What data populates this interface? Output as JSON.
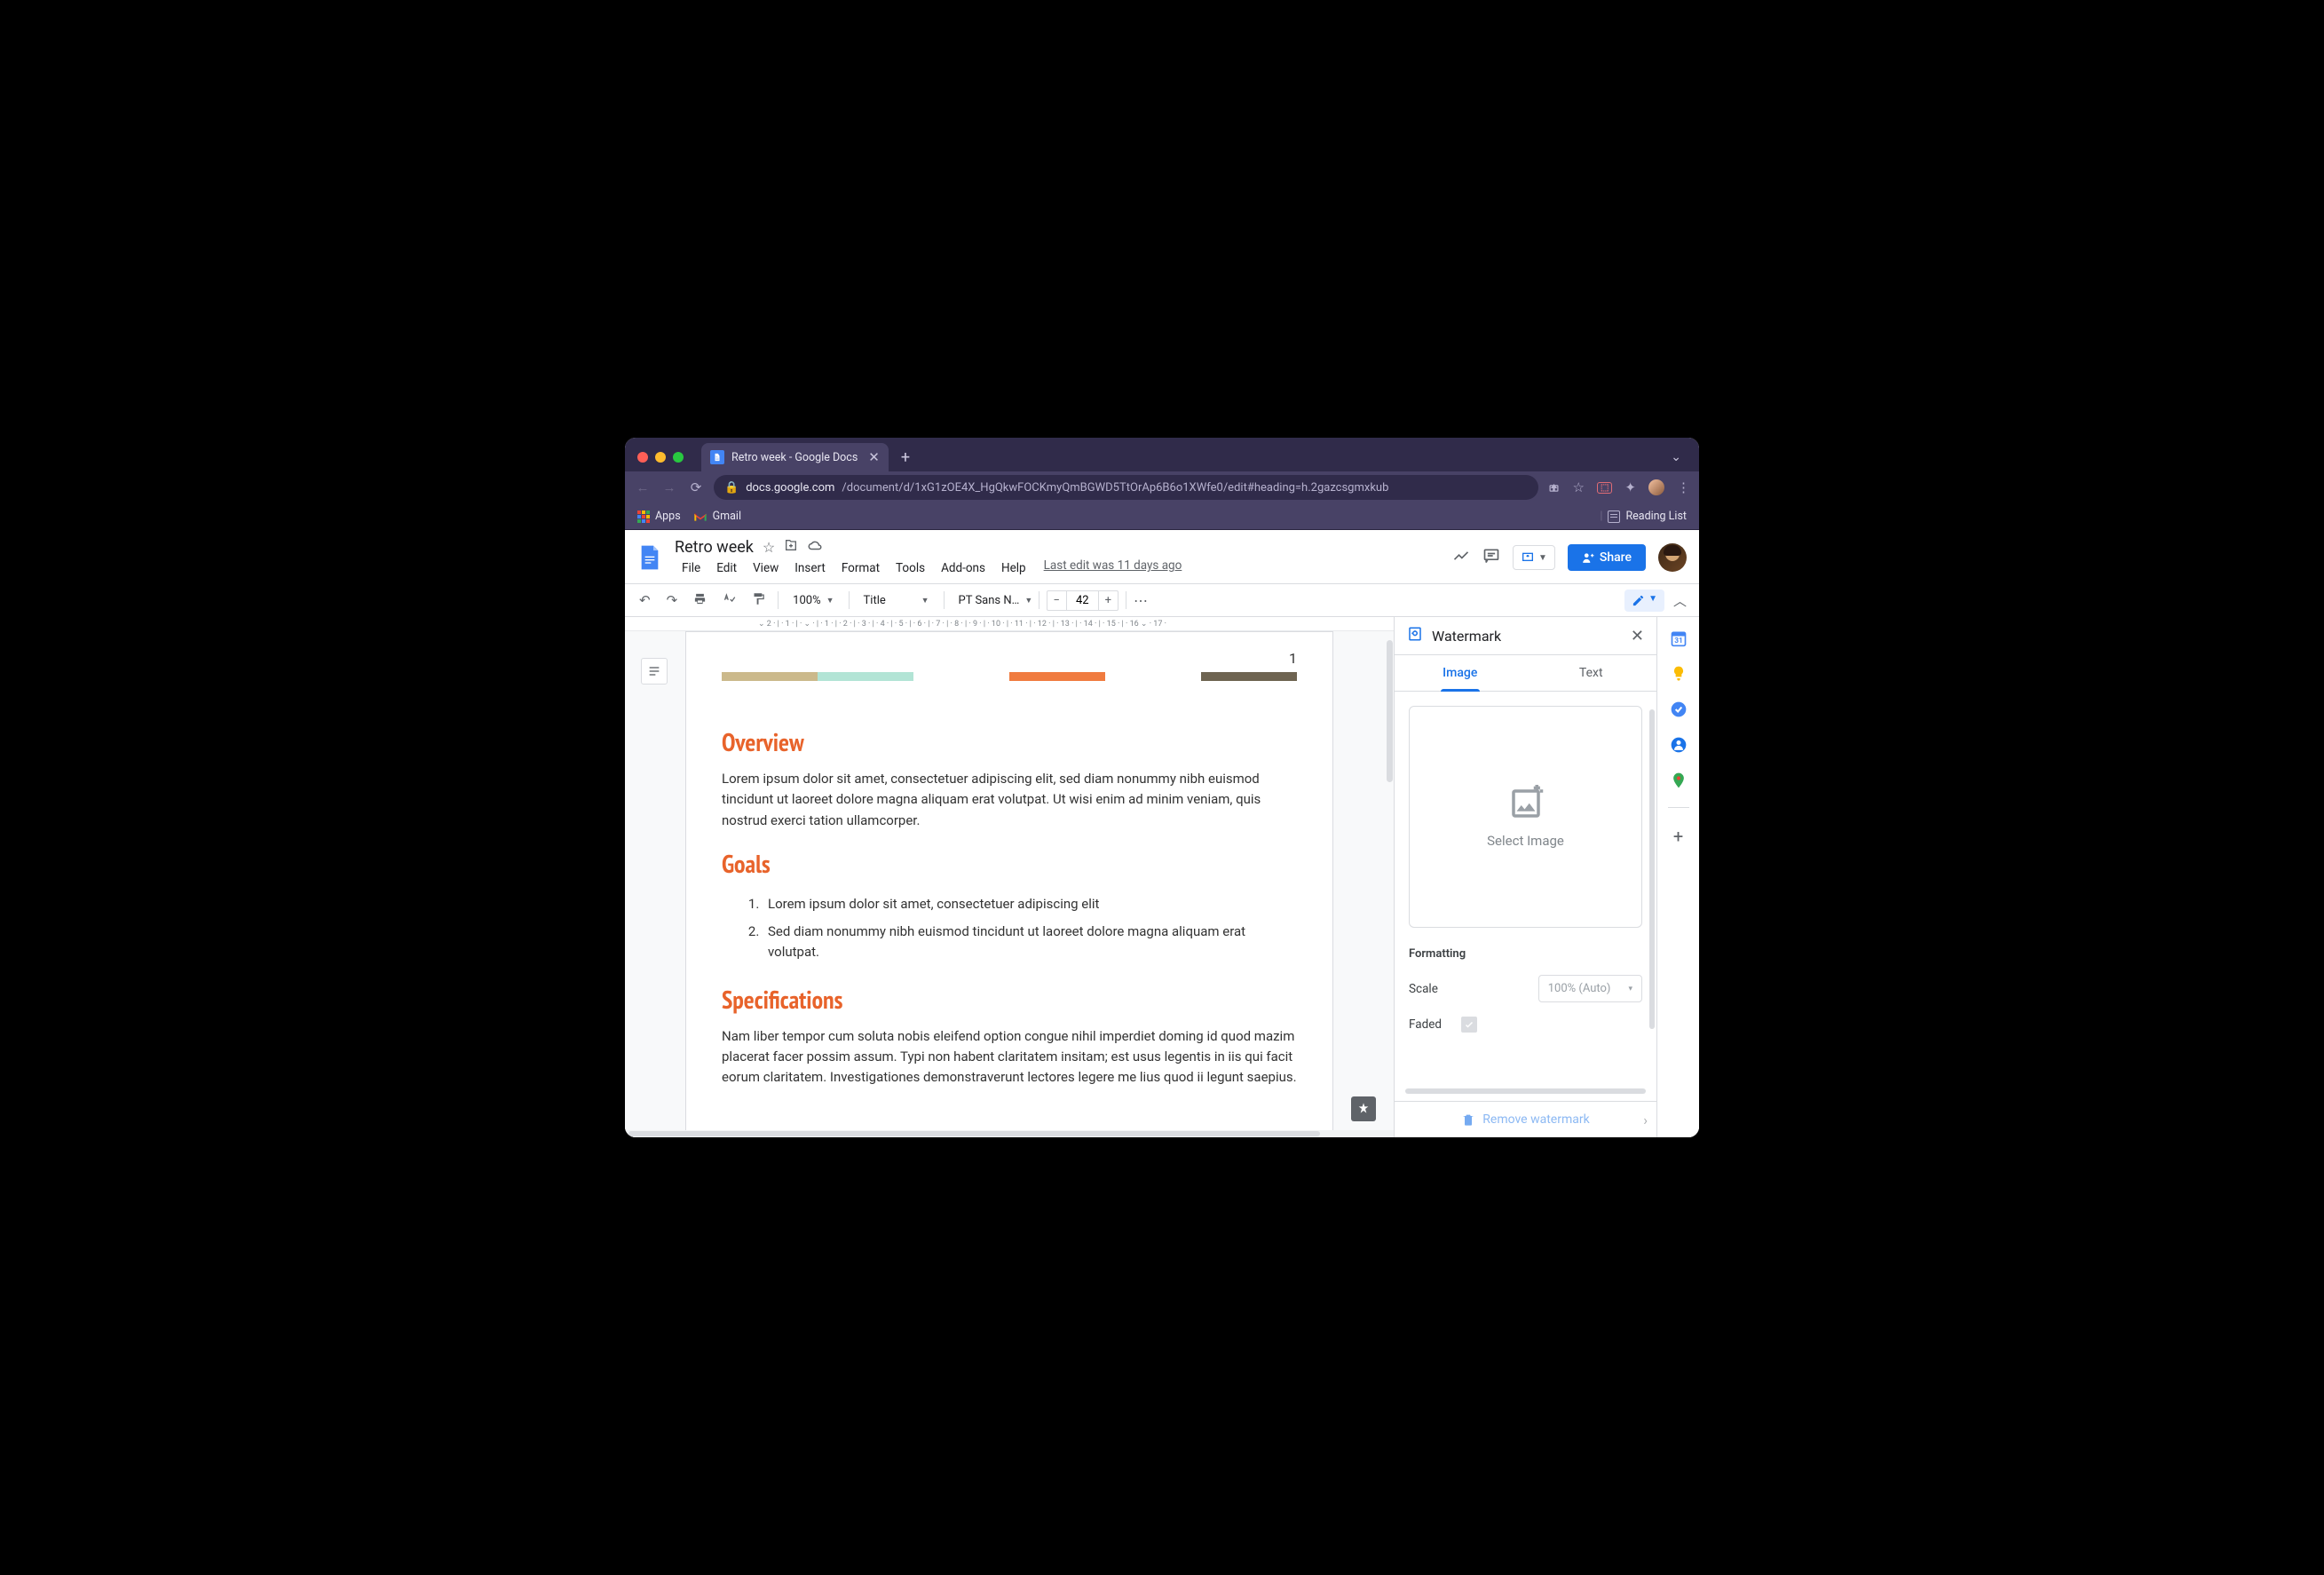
{
  "browser": {
    "tab_title": "Retro week - Google Docs",
    "url_host": "docs.google.com",
    "url_path": "/document/d/1xG1zOE4X_HgQkwFOCKmyQmBGWD5TtOrAp6B6o1XWfe0/edit#heading=h.2gazcsgmxkub",
    "bookmarks": {
      "apps": "Apps",
      "gmail": "Gmail",
      "reading_list": "Reading List"
    }
  },
  "docs": {
    "title": "Retro week",
    "menus": [
      "File",
      "Edit",
      "View",
      "Insert",
      "Format",
      "Tools",
      "Add-ons",
      "Help"
    ],
    "last_edit": "Last edit was 11 days ago",
    "share_label": "Share"
  },
  "toolbar": {
    "zoom": "100%",
    "style": "Title",
    "font": "PT Sans N…",
    "font_size": "42"
  },
  "document": {
    "page_number": "1",
    "color_bar": [
      "#cbb98b",
      "#b2e4d5",
      "#ffffff",
      "#f07b3f",
      "#ffffff",
      "#6e6451"
    ],
    "sections": [
      {
        "heading": "Overview",
        "body": "Lorem ipsum dolor sit amet, consectetuer adipiscing elit, sed diam nonummy nibh euismod tincidunt ut laoreet dolore magna aliquam erat volutpat. Ut wisi enim ad minim veniam, quis nostrud exerci tation ullamcorper."
      },
      {
        "heading": "Goals",
        "list": [
          "Lorem ipsum dolor sit amet, consectetuer adipiscing elit",
          "Sed diam nonummy nibh euismod tincidunt ut laoreet dolore magna aliquam erat volutpat."
        ]
      },
      {
        "heading": "Specifications",
        "body": "Nam liber tempor cum soluta nobis eleifend option congue nihil imperdiet doming id quod mazim placerat facer possim assum. Typi non habent claritatem insitam; est usus legentis in iis qui facit eorum claritatem. Investigationes demonstraverunt lectores legere me lius quod ii legunt saepius."
      }
    ]
  },
  "watermark_panel": {
    "title": "Watermark",
    "tabs": {
      "image": "Image",
      "text": "Text"
    },
    "select_image": "Select Image",
    "formatting_label": "Formatting",
    "scale_label": "Scale",
    "scale_value": "100% (Auto)",
    "faded_label": "Faded",
    "remove_label": "Remove watermark"
  }
}
